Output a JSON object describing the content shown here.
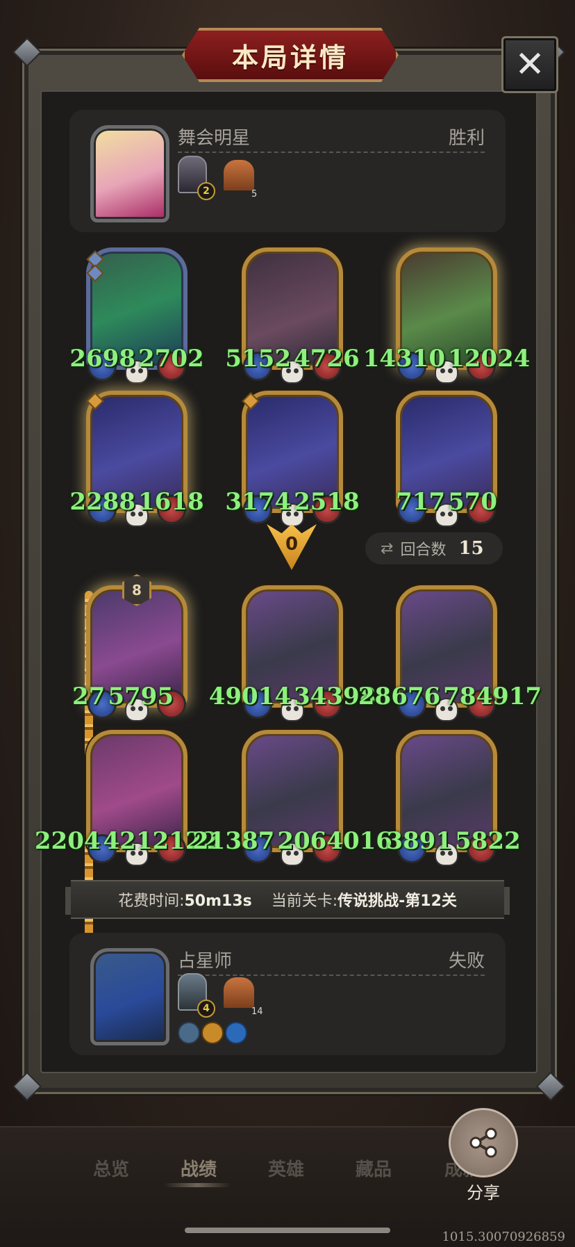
{
  "title": "本局详情",
  "close_label": "✕",
  "top_player": {
    "name": "舞会明星",
    "result": "胜利",
    "tavern_level": "2",
    "house_count": "5"
  },
  "bottom_player": {
    "name": "占星师",
    "result": "失败",
    "tavern_level": "4",
    "house_count": "14"
  },
  "top_units": [
    {
      "attack": "2698",
      "health": "2702"
    },
    {
      "attack": "5152",
      "health": "4726"
    },
    {
      "attack": "14310",
      "health": "12024"
    },
    {
      "attack": "2288",
      "health": "1618"
    },
    {
      "attack": "3174",
      "health": "2518"
    },
    {
      "attack": "717",
      "health": "570"
    }
  ],
  "bottom_units": [
    {
      "attack": "27",
      "health": "5795",
      "level": "8"
    },
    {
      "attack": "49014",
      "health": "34398"
    },
    {
      "attack": "28676",
      "health": "784917"
    },
    {
      "attack": "2204",
      "health": "4212122"
    },
    {
      "attack": "21387",
      "health": "2064016"
    },
    {
      "attack": "3891",
      "health": "5822"
    }
  ],
  "arrow_value": "0",
  "rounds": {
    "label": "回合数",
    "value": "15"
  },
  "info": {
    "time_label": "花费时间:",
    "time_value": "50m13s",
    "stage_label": "当前关卡:",
    "stage_value": "传说挑战-第12关"
  },
  "nav": {
    "overview": "总览",
    "record": "战绩",
    "heroes": "英雄",
    "collection": "藏品",
    "achievement": "成就"
  },
  "share_label": "分享",
  "footer_text": "1015.30070926859",
  "colors": {
    "stat_green": "#8ef07e",
    "gold_border": "#b58a3c",
    "title_red": "#8d1f1f"
  }
}
